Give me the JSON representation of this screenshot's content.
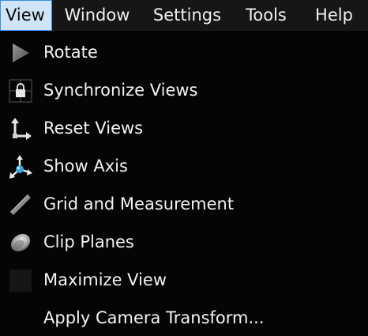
{
  "menubar": {
    "items": [
      {
        "label": "View"
      },
      {
        "label": "Window"
      },
      {
        "label": "Settings"
      },
      {
        "label": "Tools"
      },
      {
        "label": "Help"
      }
    ]
  },
  "dropdown": {
    "items": [
      {
        "label": "Rotate",
        "icon": "play-triangle-icon"
      },
      {
        "label": "Synchronize Views",
        "icon": "lock-grid-icon"
      },
      {
        "label": "Reset Views",
        "icon": "reset-axes-icon"
      },
      {
        "label": "Show Axis",
        "icon": "axis-gizmo-icon"
      },
      {
        "label": "Grid and Measurement",
        "icon": "ruler-icon"
      },
      {
        "label": "Clip Planes",
        "icon": "clip-plane-disc-icon"
      },
      {
        "label": "Maximize View",
        "icon": "maximize-square-icon"
      },
      {
        "label": "Apply Camera Transform..."
      }
    ]
  },
  "colors": {
    "active_menu_bg": "#cfe4f7",
    "active_menu_border": "#3a8ee6",
    "menubar_bg": "#161616",
    "dropdown_bg": "#050505",
    "text": "#f2f2f2"
  }
}
